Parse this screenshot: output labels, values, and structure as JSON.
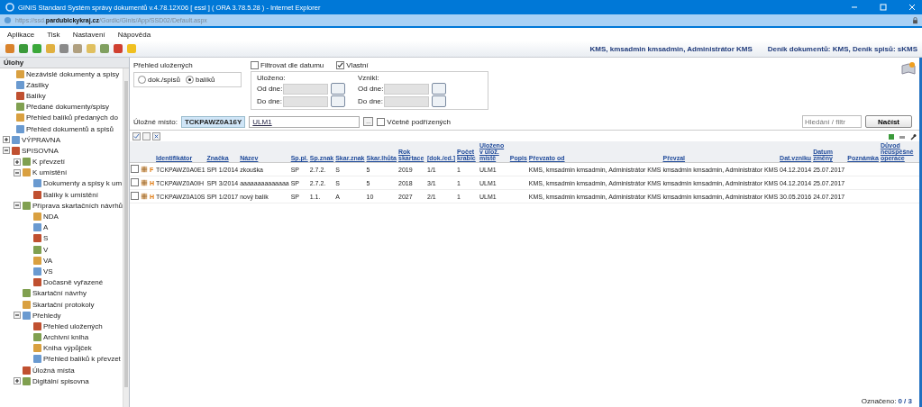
{
  "window": {
    "title": "GINIS Standard Systém správy dokumentů v.4.78.12X06 [ essl ] ( ORA 3.78.5.28 ) - Internet Explorer"
  },
  "address_bar": {
    "url": "https://ssd.**pardubickykraj.cz**/Gordic/Ginis/App/SSD02/Default.aspx"
  },
  "menu": [
    "Aplikace",
    "Tisk",
    "Nastavení",
    "Nápověda"
  ],
  "header": {
    "user": "KMS, kmsadmin kmsadmin, Administrátor KMS",
    "journals": "Deník dokumentů: KMS, Deník spisů: sKMS"
  },
  "sidebar": {
    "title": "Úlohy",
    "items_above": [
      "Nezávislé dokumenty a spisy",
      "Zásilky",
      "Balíky",
      "Předané dokumenty/spisy",
      "Přehled balíků předaných do",
      "Přehled dokumentů a spisů"
    ],
    "tree": [
      {
        "label": "VÝPRAVNA",
        "expanded": false
      },
      {
        "label": "SPISOVNA",
        "expanded": true,
        "children": [
          {
            "label": "K převzetí",
            "expanded": false
          },
          {
            "label": "K umístění",
            "expanded": true,
            "children": [
              {
                "label": "Dokumenty a spisy k um"
              },
              {
                "label": "Balíky k umístění"
              }
            ]
          },
          {
            "label": "Příprava skartačních návrhů",
            "expanded": true,
            "children": [
              {
                "label": "NDA"
              },
              {
                "label": "A"
              },
              {
                "label": "S"
              },
              {
                "label": "V"
              },
              {
                "label": "VA"
              },
              {
                "label": "VS"
              },
              {
                "label": "Dočasně vyřazené"
              }
            ]
          },
          {
            "label": "Skartační návrhy"
          },
          {
            "label": "Skartační protokoly"
          },
          {
            "label": "Přehledy",
            "expanded": true,
            "children": [
              {
                "label": "Přehled uložených"
              },
              {
                "label": "Archivní kniha"
              },
              {
                "label": "Kniha výpůjček"
              },
              {
                "label": "Přehled balíků k převzet"
              }
            ]
          },
          {
            "label": "Úložná místa"
          },
          {
            "label": "Digitální spisovna",
            "expanded": false
          }
        ]
      }
    ]
  },
  "filter": {
    "title": "Přehled uložených",
    "modes": [
      {
        "label": "dok./spisů",
        "selected": false
      },
      {
        "label": "balíků",
        "selected": true
      }
    ],
    "checks": [
      {
        "label": "Filtrovat dle datumu",
        "checked": false
      },
      {
        "label": "Vlastní",
        "checked": true
      }
    ],
    "date_groups": [
      {
        "title": "Uloženo:",
        "from_label": "Od dne:",
        "to_label": "Do dne:",
        "disabled": true
      },
      {
        "title": "Vznikl:",
        "from_label": "Od dne:",
        "to_label": "Do dne:",
        "disabled": true
      }
    ],
    "location_label": "Úložné místo:",
    "location_code": "TCKPAWZ0A16Y",
    "location_name": "ULM1",
    "browse_button": "...",
    "include_sub": {
      "label": "Včetně podřízených",
      "checked": false
    },
    "search": {
      "placeholder": "Hledání / filtr"
    },
    "load_button": "Načíst"
  },
  "table": {
    "columns": [
      "Identifikátor",
      "Značka",
      "Název",
      "Sp.pl.",
      "Sp.znak",
      "Skar.znak",
      "Skar.lhůta",
      "Rok skartace",
      "[dok./ed.]",
      "Počet krabic",
      "Uloženo v úlož. místě",
      "Popis",
      "Převzato od",
      "Převzal",
      "Dat.vzniku",
      "Datum změny",
      "Poznámka",
      "Důvod neúspěšné operace"
    ],
    "rows": [
      {
        "checked": false,
        "type": "F",
        "cells": [
          "TCKPAWZ0A0E1",
          "SPI 1/2014",
          "zkouška",
          "SP",
          "2.7.2.",
          "S",
          "5",
          "2019",
          "1/1",
          "1",
          "ULM1",
          null,
          "KMS, kmsadmin kmsadmin, Administrátor KMS",
          "kmsadmin kmsadmin, Administrátor KMS",
          "04.12.2014",
          "25.07.2017",
          null,
          null
        ]
      },
      {
        "checked": false,
        "type": "H",
        "cells": [
          "TCKPAWZ0A0IH",
          "SPI 3/2014",
          "aaaaaaaaaaaaaa",
          "SP",
          "2.7.2.",
          "S",
          "5",
          "2018",
          "3/1",
          "1",
          "ULM1",
          null,
          "KMS, kmsadmin kmsadmin, Administrátor KMS",
          "kmsadmin kmsadmin, Administrátor KMS",
          "04.12.2014",
          "25.07.2017",
          null,
          null
        ]
      },
      {
        "checked": false,
        "type": "H",
        "cells": [
          "TCKPAWZ0A10S",
          "SPI 1/2017",
          "nový balík",
          "SP",
          "1.1.",
          "A",
          "10",
          "2027",
          "2/1",
          "1",
          "ULM1",
          null,
          "KMS, kmsadmin kmsadmin, Administrátor KMS",
          "kmsadmin kmsadmin, Administrátor KMS",
          "30.05.2016",
          "24.07.2017",
          null,
          null
        ]
      }
    ]
  },
  "status": {
    "label": "Označeno:",
    "count": "0 / 3"
  }
}
